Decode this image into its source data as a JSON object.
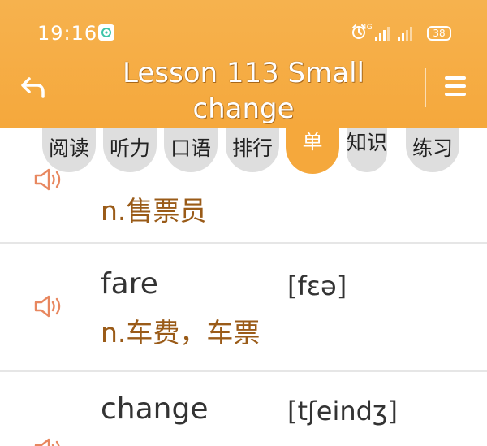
{
  "status_bar": {
    "time": "19:16",
    "network_label": "4G",
    "battery": "38"
  },
  "header": {
    "title": "Lesson 113 Small change"
  },
  "tabs": [
    {
      "label": "阅读"
    },
    {
      "label": "听力"
    },
    {
      "label": "口语"
    },
    {
      "label": "排行"
    },
    {
      "label": "单"
    },
    {
      "label": "知识"
    },
    {
      "label": "练习"
    }
  ],
  "words": [
    {
      "word": "",
      "phonetic": "",
      "meaning": "n.售票员"
    },
    {
      "word": "fare",
      "phonetic": "[fɛə]",
      "meaning": "n.车费，车票"
    },
    {
      "word": "change",
      "phonetic": "[tʃeindʒ]",
      "meaning": ""
    }
  ],
  "colors": {
    "accent": "#f5a83c",
    "meaning_text": "#9a5b18",
    "tab_inactive": "#dedede"
  }
}
